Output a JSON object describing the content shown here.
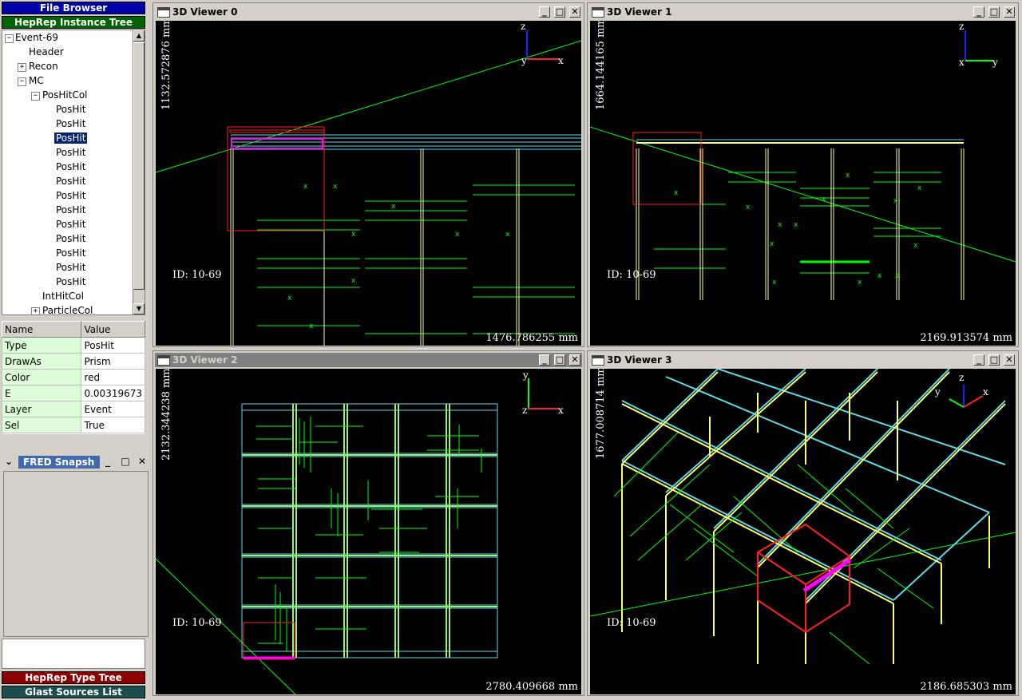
{
  "left_panel": {
    "file_browser": "File Browser",
    "instance_tree": "HepRep Instance Tree",
    "type_tree": "HepRep Type Tree",
    "sources_list": "Glast Sources List",
    "tree": {
      "root": "Event-69",
      "header": "Header",
      "recon": "Recon",
      "mc": "MC",
      "poshitcol": "PosHitCol",
      "poshits": [
        "PosHit",
        "PosHit",
        "PosHit",
        "PosHit",
        "PosHit",
        "PosHit",
        "PosHit",
        "PosHit",
        "PosHit",
        "PosHit",
        "PosHit",
        "PosHit",
        "PosHit"
      ],
      "inthitcol": "IntHitCol",
      "particlecol": "ParticleCol"
    },
    "props": {
      "col_name": "Name",
      "col_value": "Value",
      "rows": [
        {
          "name": "Type",
          "value": "PosHit"
        },
        {
          "name": "DrawAs",
          "value": "Prism"
        },
        {
          "name": "Color",
          "value": "red"
        },
        {
          "name": "E",
          "value": "0.00319673"
        },
        {
          "name": "Layer",
          "value": "Event"
        },
        {
          "name": "Sel",
          "value": "True"
        }
      ]
    },
    "snapshot_title": "FRED Snapsh"
  },
  "viewers": [
    {
      "title": "3D Viewer 0",
      "id": "ID: 10-69",
      "vscale": "1132.572876 mm",
      "hscale": "1476.786255 mm",
      "axes": [
        "z",
        "y",
        "x"
      ]
    },
    {
      "title": "3D Viewer 1",
      "id": "ID: 10-69",
      "vscale": "1664.144165 mm",
      "hscale": "2169.913574 mm",
      "axes": [
        "z",
        "x",
        "y"
      ]
    },
    {
      "title": "3D Viewer 2",
      "id": "ID: 10-69",
      "vscale": "2132.344238 mm",
      "hscale": "2780.409668 mm",
      "axes": [
        "y",
        "z",
        "x"
      ]
    },
    {
      "title": "3D Viewer 3",
      "id": "ID: 10-69",
      "vscale": "1677.008714 mm",
      "hscale": "2186.685303 mm",
      "axes": [
        "z",
        "y",
        "x"
      ]
    }
  ],
  "colors": {
    "active_title": "#0000a8",
    "tree_header": "#006400",
    "type_tree": "#8b0000",
    "sources": "#1c4e4e",
    "track": "#00ff00",
    "cyan": "#5fd7e6",
    "yellow": "#ffff66",
    "red": "#ff2020",
    "magenta": "#ff00ff"
  }
}
